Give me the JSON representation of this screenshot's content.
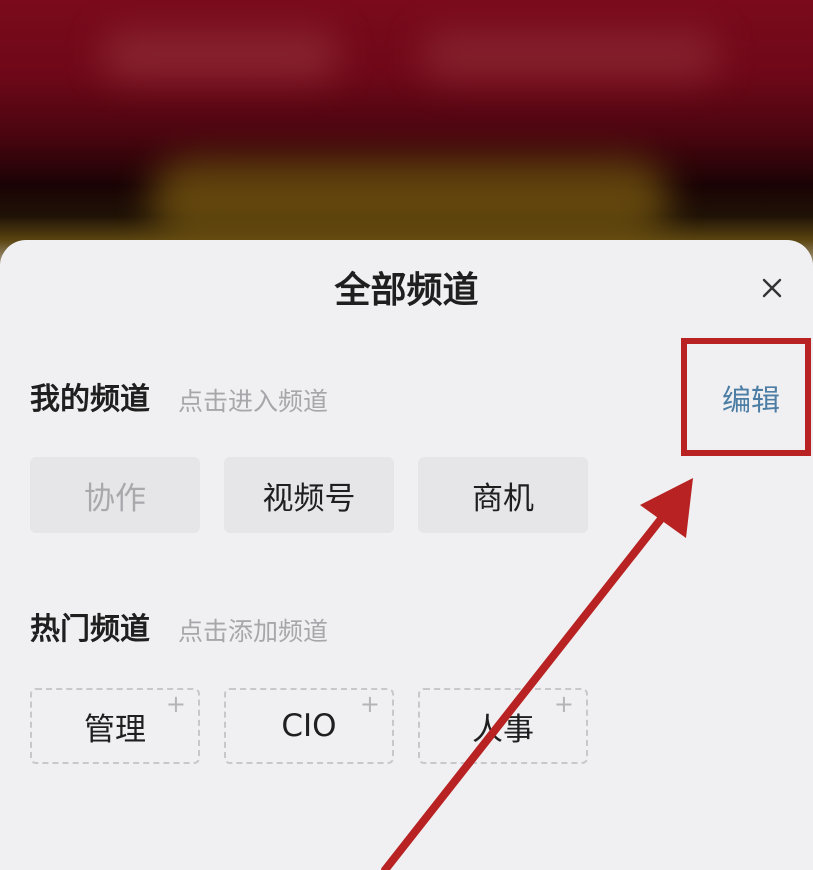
{
  "sheet": {
    "title": "全部频道",
    "close_icon": "close-icon"
  },
  "my_channels": {
    "title": "我的频道",
    "hint": "点击进入频道",
    "edit_label": "编辑",
    "items": [
      {
        "label": "协作",
        "state": "disabled"
      },
      {
        "label": "视频号",
        "state": "normal"
      },
      {
        "label": "商机",
        "state": "normal"
      }
    ]
  },
  "hot_channels": {
    "title": "热门频道",
    "hint": "点击添加频道",
    "add_symbol": "+",
    "items": [
      {
        "label": "管理"
      },
      {
        "label": "CIO"
      },
      {
        "label": "人事"
      }
    ]
  },
  "annotation": {
    "color": "#b82222",
    "highlight_target": "edit-link",
    "arrow_icon": "arrow-icon"
  },
  "colors": {
    "accent_link": "#4c7da4",
    "sheet_bg": "#f0f0f3"
  }
}
